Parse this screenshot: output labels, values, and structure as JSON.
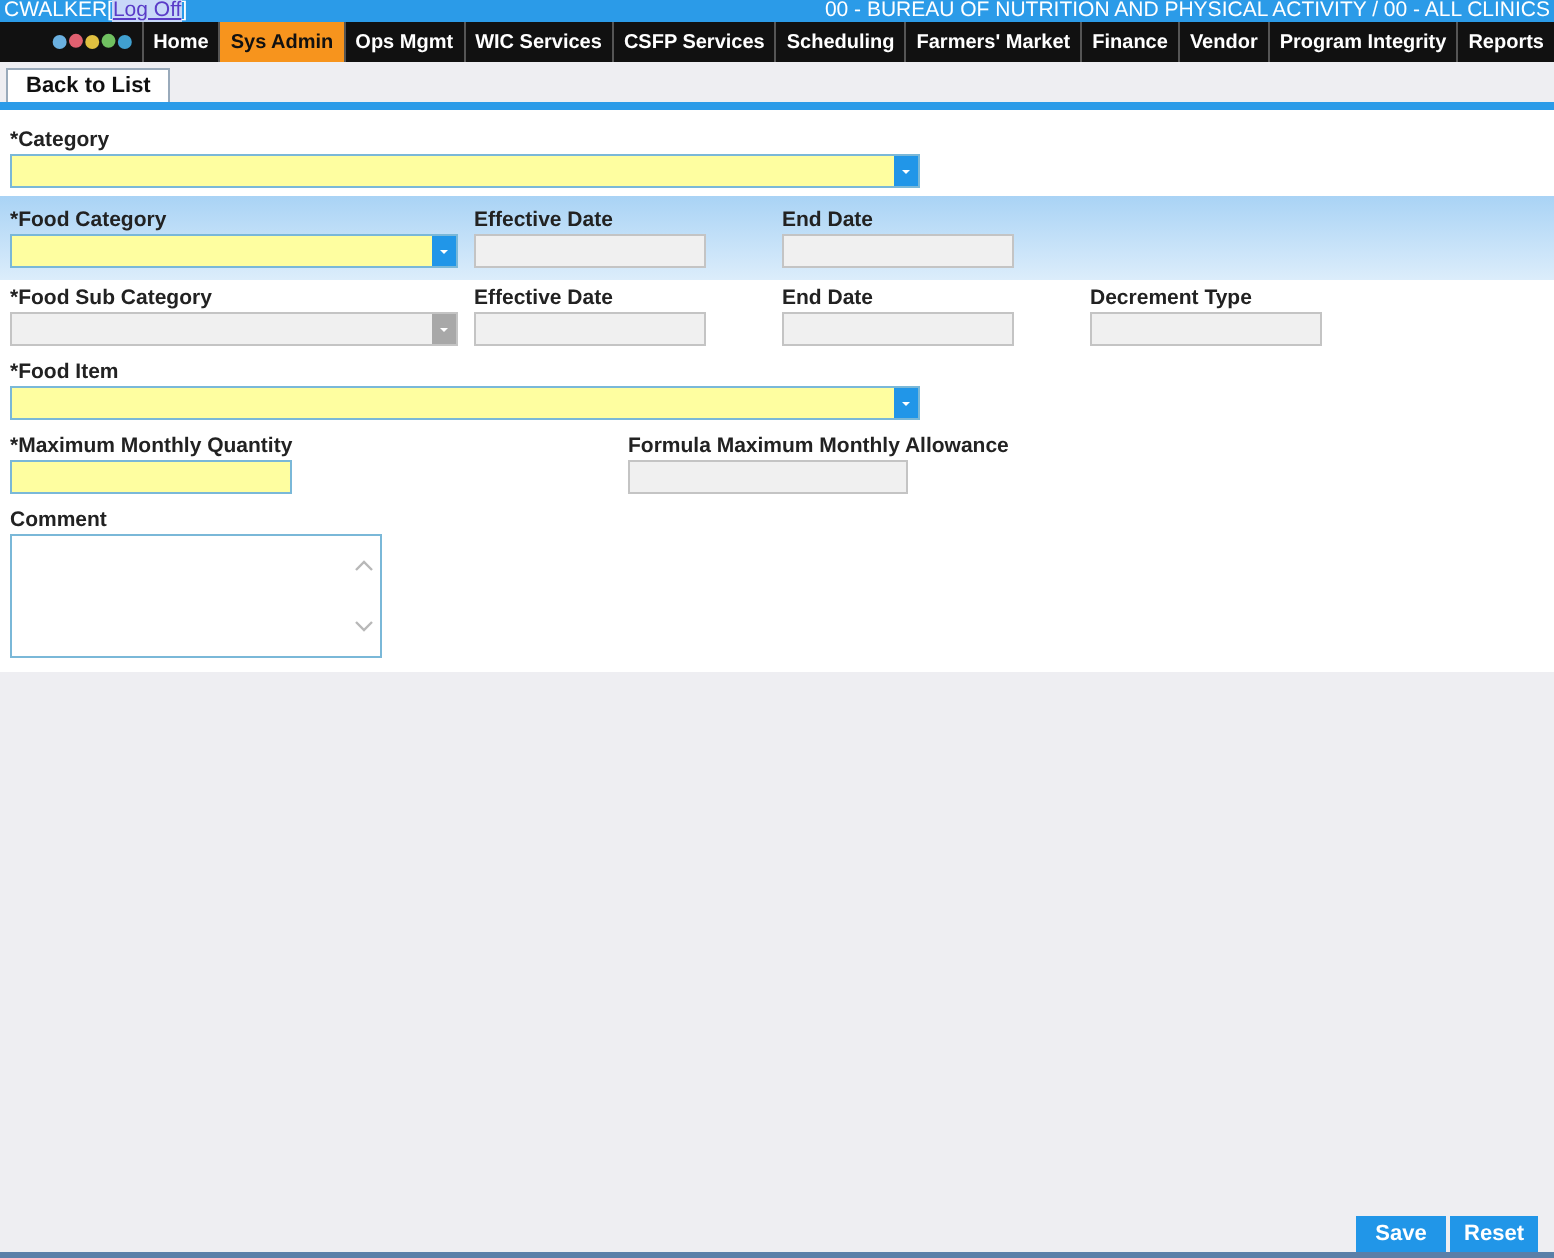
{
  "header": {
    "user": "CWALKER",
    "bracket_open": "[",
    "logoff_link": "Log Off",
    "bracket_close": "]",
    "agency": "00 - BUREAU OF NUTRITION AND PHYSICAL ACTIVITY / 00 - ALL CLINICS"
  },
  "menu": [
    {
      "label": "Home",
      "selected": false
    },
    {
      "label": "Sys Admin",
      "selected": true
    },
    {
      "label": "Ops Mgmt",
      "selected": false
    },
    {
      "label": "WIC Services",
      "selected": false
    },
    {
      "label": "CSFP Services",
      "selected": false
    },
    {
      "label": "Scheduling",
      "selected": false
    },
    {
      "label": "Farmers' Market",
      "selected": false
    },
    {
      "label": "Finance",
      "selected": false
    },
    {
      "label": "Vendor",
      "selected": false
    },
    {
      "label": "Program Integrity",
      "selected": false
    },
    {
      "label": "Reports",
      "selected": false
    }
  ],
  "toolbar": {
    "back_button": "Back to List"
  },
  "form_rows": [
    {
      "highlighted": false,
      "fields": [
        {
          "label": "*Category",
          "kind": "select",
          "required": true,
          "disabled": false
        }
      ]
    },
    {
      "highlighted": true,
      "fields": [
        {
          "label": "*Food Category",
          "kind": "select",
          "required": true,
          "disabled": false
        },
        {
          "label": "Effective Date",
          "kind": "text",
          "required": false,
          "disabled": true
        },
        {
          "label": "End Date",
          "kind": "text",
          "required": false,
          "disabled": true
        }
      ]
    },
    {
      "highlighted": false,
      "fields": [
        {
          "label": "*Food Sub Category",
          "kind": "select",
          "required": false,
          "disabled": true
        },
        {
          "label": "Effective Date",
          "kind": "text",
          "required": false,
          "disabled": true
        },
        {
          "label": "End Date",
          "kind": "text",
          "required": false,
          "disabled": true
        },
        {
          "label": "Decrement Type",
          "kind": "text",
          "required": false,
          "disabled": true
        }
      ]
    },
    {
      "highlighted": false,
      "fields": [
        {
          "label": "*Food Item",
          "kind": "select",
          "required": true,
          "disabled": false
        }
      ]
    },
    {
      "highlighted": false,
      "fields": [
        {
          "label": "*Maximum Monthly Quantity",
          "kind": "text",
          "required": true,
          "disabled": false
        },
        {
          "label": "Formula Maximum Monthly Allowance",
          "kind": "text",
          "required": false,
          "disabled": true
        }
      ]
    },
    {
      "highlighted": false,
      "fields": [
        {
          "label": "Comment",
          "kind": "textarea",
          "required": false,
          "disabled": false
        }
      ]
    }
  ],
  "footer_buttons": [
    "Save",
    "Reset"
  ]
}
